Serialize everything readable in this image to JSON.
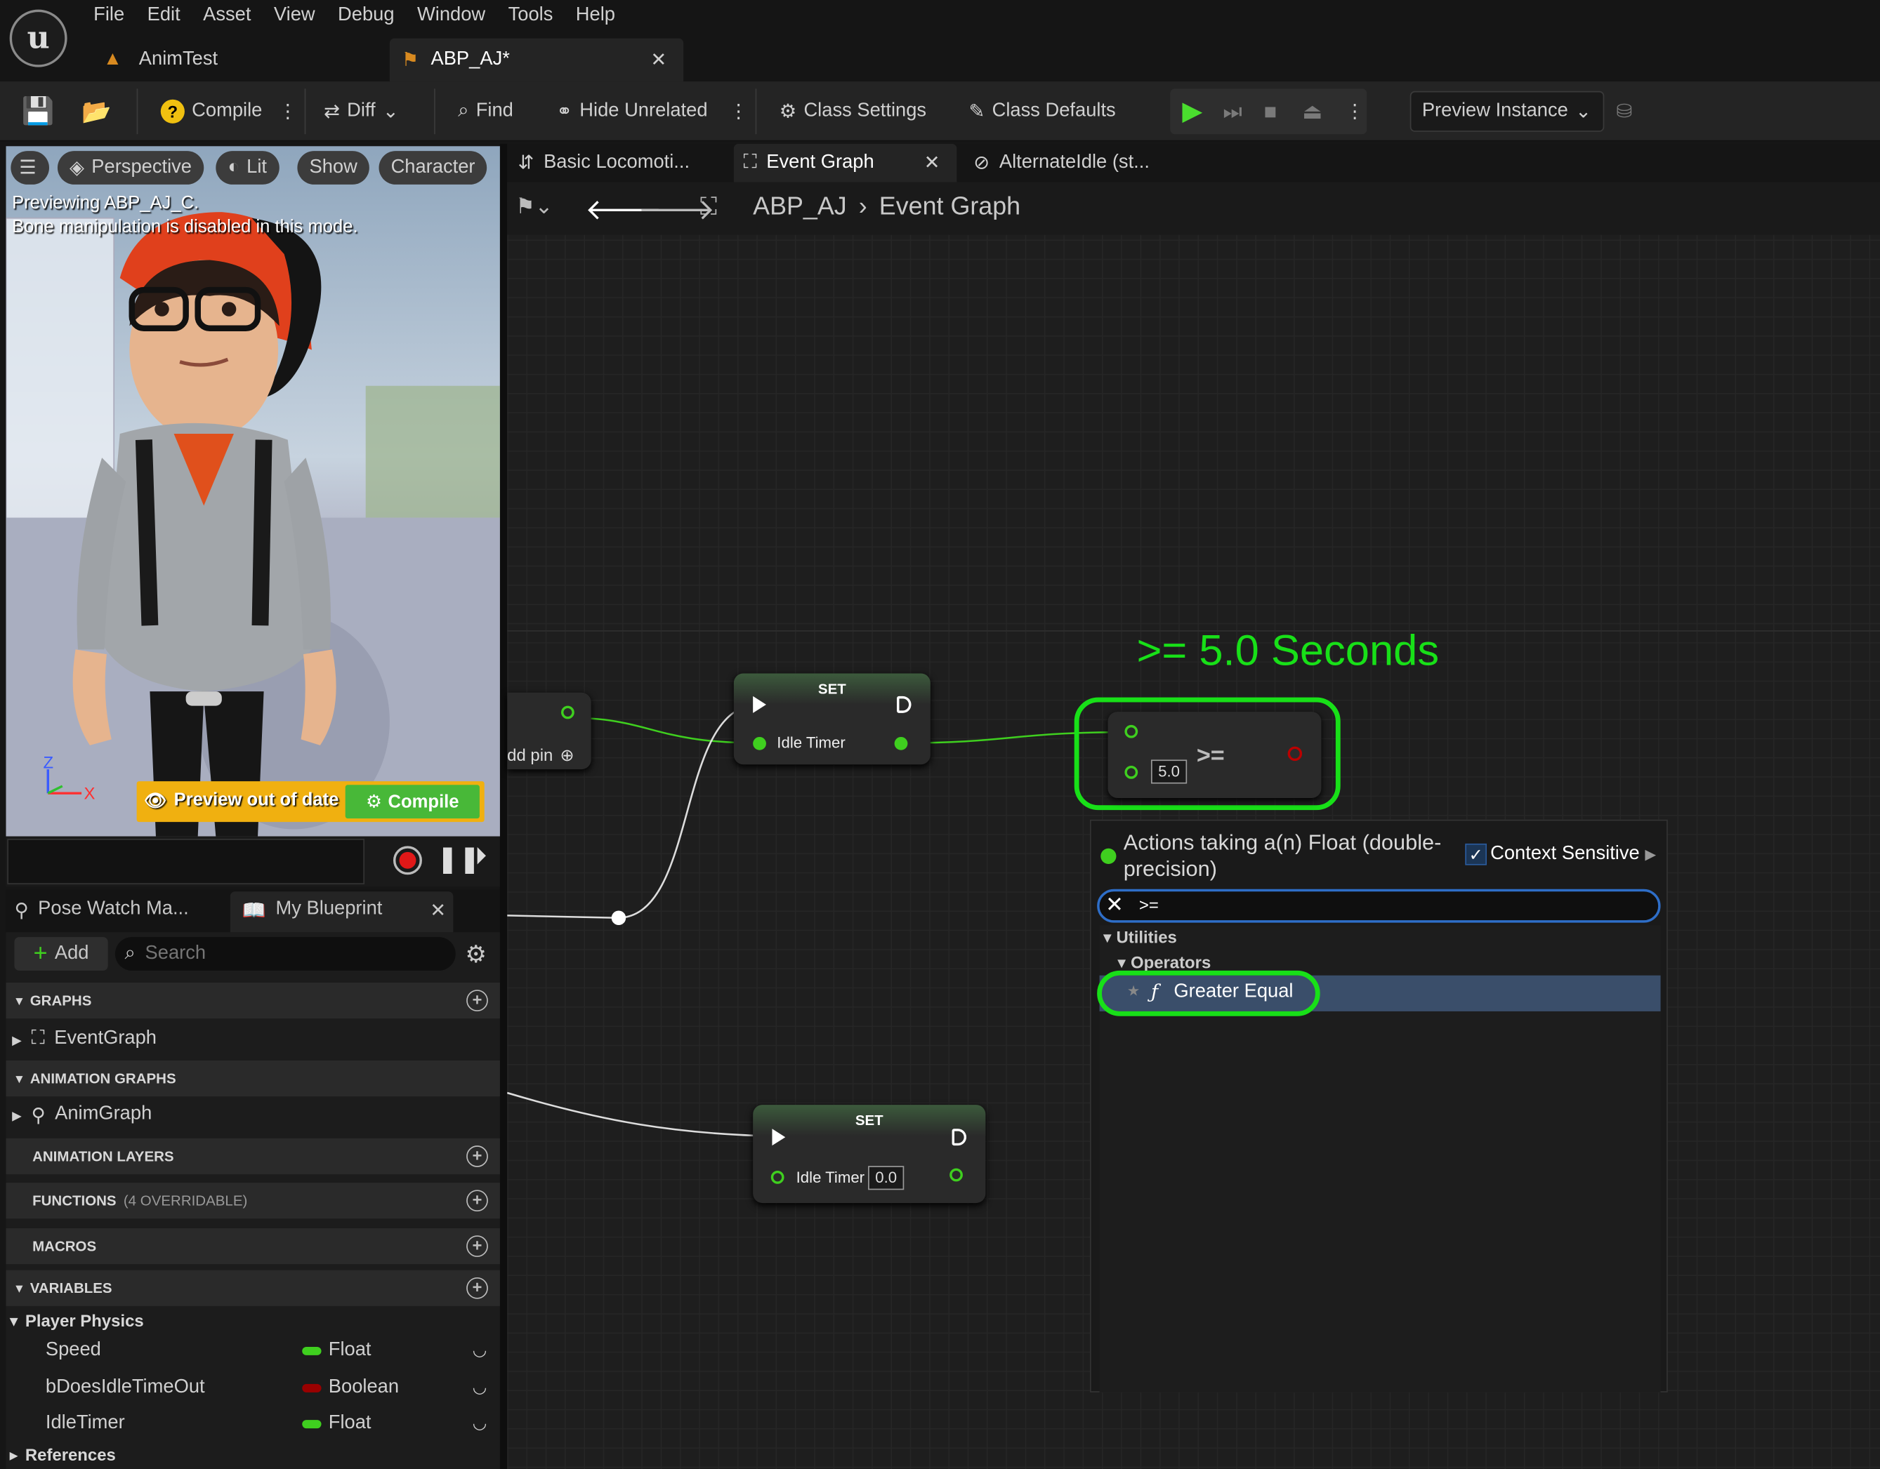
{
  "menu": [
    "File",
    "Edit",
    "Asset",
    "View",
    "Debug",
    "Window",
    "Tools",
    "Help"
  ],
  "doc_tabs": [
    {
      "label": "AnimTest"
    },
    {
      "label": "ABP_AJ*"
    }
  ],
  "toolbar": {
    "compile": "Compile",
    "diff": "Diff",
    "find": "Find",
    "hide_unrelated": "Hide Unrelated",
    "class_settings": "Class Settings",
    "class_defaults": "Class Defaults",
    "preview_instance": "Preview Instance"
  },
  "viewport": {
    "buttons": [
      "Perspective",
      "Lit",
      "Show",
      "Character"
    ],
    "preview_line1": "Previewing ABP_AJ_C.",
    "preview_line2": "Bone manipulation is disabled in this mode.",
    "axis_z": "Z",
    "axis_x": "X",
    "out_of_date": "Preview out of date",
    "compile": "Compile"
  },
  "panel_tabs": {
    "pose_watch": "Pose Watch Ma...",
    "my_blueprint": "My Blueprint"
  },
  "my_blueprint": {
    "add": "Add",
    "search_placeholder": "Search",
    "graphs_header": "GRAPHS",
    "event_graph": "EventGraph",
    "anim_graphs_header": "ANIMATION GRAPHS",
    "anim_graph": "AnimGraph",
    "anim_layers_header": "ANIMATION LAYERS",
    "functions_header": "FUNCTIONS",
    "functions_note": "(4 OVERRIDABLE)",
    "macros_header": "MACROS",
    "variables_header": "VARIABLES",
    "category": "Player Physics",
    "variables": [
      {
        "name": "Speed",
        "type": "Float",
        "color": "#3fcf1f"
      },
      {
        "name": "bDoesIdleTimeOut",
        "type": "Boolean",
        "color": "#9a0000"
      },
      {
        "name": "IdleTimer",
        "type": "Float",
        "color": "#3fcf1f"
      }
    ],
    "references": "References"
  },
  "graph_tabs": [
    {
      "label": "Basic Locomoti..."
    },
    {
      "label": "Event Graph"
    },
    {
      "label": "AlternateIdle (st..."
    }
  ],
  "breadcrumb": {
    "root": "ABP_AJ",
    "current": "Event Graph"
  },
  "nodes": {
    "partial_label": "dd pin",
    "set1": {
      "title": "SET",
      "var": "Idle Timer"
    },
    "set2": {
      "title": "SET",
      "var": "Idle Timer",
      "value": "0.0"
    },
    "compare": {
      "op": ">=",
      "value": "5.0"
    }
  },
  "annotation": ">= 5.0 Seconds",
  "action_menu": {
    "title_line1": "Actions taking a(n) Float (double-",
    "title_line2": "precision)",
    "context_sensitive": "Context Sensitive",
    "search_value": ">=",
    "cat_utilities": "Utilities",
    "cat_operators": "Operators",
    "result": "Greater Equal"
  },
  "colors": {
    "accent_green": "#18e018",
    "float_pin": "#3fcf1f",
    "bool_pin": "#9a0000",
    "selected_row": "#3a4e6a"
  }
}
